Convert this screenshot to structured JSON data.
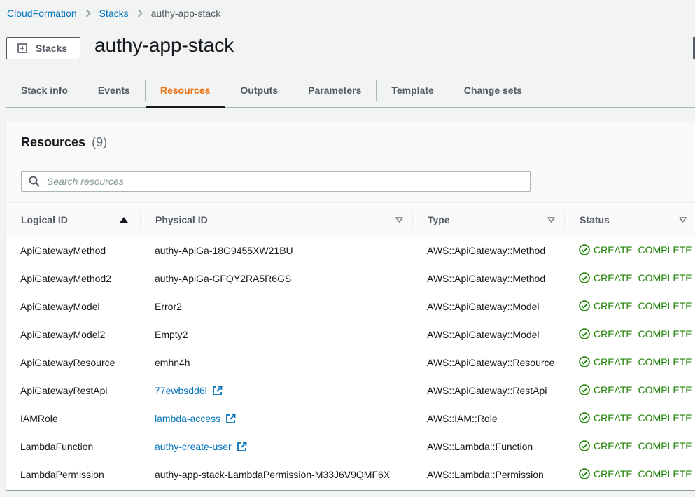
{
  "breadcrumb": {
    "items": [
      "CloudFormation",
      "Stacks"
    ],
    "current": "authy-app-stack"
  },
  "header": {
    "stacks_button": "Stacks",
    "title": "authy-app-stack"
  },
  "tabs": [
    {
      "label": "Stack info",
      "active": false
    },
    {
      "label": "Events",
      "active": false
    },
    {
      "label": "Resources",
      "active": true
    },
    {
      "label": "Outputs",
      "active": false
    },
    {
      "label": "Parameters",
      "active": false
    },
    {
      "label": "Template",
      "active": false
    },
    {
      "label": "Change sets",
      "active": false
    }
  ],
  "resources": {
    "title": "Resources",
    "count": "(9)",
    "search_placeholder": "Search resources",
    "columns": [
      "Logical ID",
      "Physical ID",
      "Type",
      "Status"
    ],
    "rows": [
      {
        "logical_id": "ApiGatewayMethod",
        "physical_id": "authy-ApiGa-18G9455XW21BU",
        "physical_link": false,
        "type": "AWS::ApiGateway::Method",
        "status": "CREATE_COMPLETE"
      },
      {
        "logical_id": "ApiGatewayMethod2",
        "physical_id": "authy-ApiGa-GFQY2RA5R6GS",
        "physical_link": false,
        "type": "AWS::ApiGateway::Method",
        "status": "CREATE_COMPLETE"
      },
      {
        "logical_id": "ApiGatewayModel",
        "physical_id": "Error2",
        "physical_link": false,
        "type": "AWS::ApiGateway::Model",
        "status": "CREATE_COMPLETE"
      },
      {
        "logical_id": "ApiGatewayModel2",
        "physical_id": "Empty2",
        "physical_link": false,
        "type": "AWS::ApiGateway::Model",
        "status": "CREATE_COMPLETE"
      },
      {
        "logical_id": "ApiGatewayResource",
        "physical_id": "emhn4h",
        "physical_link": false,
        "type": "AWS::ApiGateway::Resource",
        "status": "CREATE_COMPLETE"
      },
      {
        "logical_id": "ApiGatewayRestApi",
        "physical_id": "77ewbsdd6l",
        "physical_link": true,
        "type": "AWS::ApiGateway::RestApi",
        "status": "CREATE_COMPLETE"
      },
      {
        "logical_id": "IAMRole",
        "physical_id": "lambda-access",
        "physical_link": true,
        "type": "AWS::IAM::Role",
        "status": "CREATE_COMPLETE"
      },
      {
        "logical_id": "LambdaFunction",
        "physical_id": "authy-create-user",
        "physical_link": true,
        "type": "AWS::Lambda::Function",
        "status": "CREATE_COMPLETE"
      },
      {
        "logical_id": "LambdaPermission",
        "physical_id": "authy-app-stack-LambdaPermission-M33J6V9QMF6X",
        "physical_link": false,
        "type": "AWS::Lambda::Permission",
        "status": "CREATE_COMPLETE"
      }
    ]
  },
  "colors": {
    "link": "#0073bb",
    "active_tab": "#ec7211",
    "status_success": "#1d8102"
  },
  "icons": {
    "breadcrumb_separator": "chevron-right-icon",
    "stacks_button": "plus-square-icon",
    "search": "search-icon",
    "external_link": "external-link-icon",
    "status": "check-circle-icon",
    "sort_ascending": "caret-up-filled-icon",
    "sort_unsorted": "caret-down-outline-icon"
  }
}
